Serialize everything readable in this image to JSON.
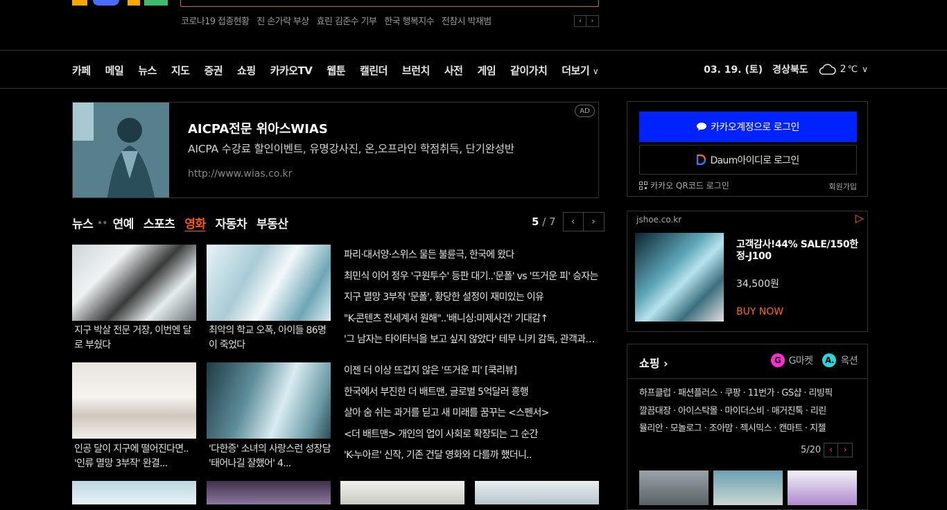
{
  "hot_keywords": [
    "코로나19 접종현황",
    "진 손가락 부상",
    "효린 김준수 기부",
    "한국 행복지수",
    "전참시 박재범"
  ],
  "nav": {
    "items": [
      "카페",
      "메일",
      "뉴스",
      "지도",
      "증권",
      "쇼핑",
      "카카오TV",
      "웹툰",
      "캘린더",
      "브런치",
      "사전",
      "게임",
      "같이가치",
      "더보기"
    ],
    "date": "03. 19. (토)",
    "region": "경상북도",
    "temperature": "2",
    "temp_unit": "℃"
  },
  "ad": {
    "title": "AICPA전문 위아스WIAS",
    "desc": "AICPA 수강료 할인이벤트, 유명강사진, 온,오프라인 학점취득, 단기완성반",
    "url": "http://www.wias.co.kr",
    "badge": "AD"
  },
  "news": {
    "tabs": [
      "뉴스",
      "연예",
      "스포츠",
      "영화",
      "자동차",
      "부동산"
    ],
    "active_tab": "영화",
    "page_current": "5",
    "page_total": "/ 7",
    "thumbs": [
      {
        "caption": "지구 박살 전문 거장, 이번엔 달로 부쉈다"
      },
      {
        "caption": "최악의 학교 오폭, 아이들 86명이 죽었다"
      },
      {
        "caption": "인공 달이 지구에 떨어진다면.. '인류 멸망 3부작' 완결..."
      },
      {
        "caption": "'다한증' 소녀의 사랑스런 성장담 '태어나길 잘했어' 4..."
      }
    ],
    "list1": [
      "파리·대서양·스위스 물든 불륜극, 한국에 왔다",
      "최민식 이어 정우 '구원투수' 등판 대기..'문폴' vs '뜨거운 피' 승자는",
      "지구 멸망 3부작 '문폴', 황당한 설정이 재미있는 이유",
      "\"K-콘텐츠 전세계서 원해\"..'배니싱:미제사건' 기대감↑",
      "'그 남자는 타이타닉을 보고 싶지 않았다' 테무 니키 감독, 관객과의 대화"
    ],
    "list2": [
      "이젠 더 이상 뜨겁지 않은 '뜨거운 피' [쿡리뷰]",
      "한국에서 부진한 더 배트맨, 글로벌 5억달러 흥행",
      "살아 숨 쉬는 과거를 딛고 새 미래를 꿈꾸는 <스펜서>",
      "<더 배트맨> 개인의 업이 사회로 확장되는 그 순간",
      "'K-누아르' 신작, 기존 건달 영화와 다를까 했더니.."
    ]
  },
  "login": {
    "kakao_label": "카카오계정으로 로그인",
    "daum_label": "Daum아이디로 로그인",
    "qr_label": "카카오 QR코드 로그인",
    "signup_label": "회원가입"
  },
  "shop_ad": {
    "domain": "jshoe.co.kr",
    "title": "고객감사!44% SALE/150한정-J100",
    "price": "34,500원",
    "cta": "BUY NOW"
  },
  "shopping": {
    "title": "쇼핑 ›",
    "gmarket": "G마켓",
    "auction": "옥션",
    "lines": [
      "하프클럽 · 패션플러스 · 쿠팡 · 11번가 · GS샵 · 리빙픽",
      "깔끔대장 · 아이스탁몰 · 마이더스비 · 매거진톡 · 리린",
      "뮬리안 · 모놀로그 · 조아맘 · 젝시믹스 · 캔마트 · 지젤"
    ],
    "page": "5/20"
  },
  "colors": {
    "accent": "#ff5a00",
    "kakao_blue": "#0022ff"
  }
}
